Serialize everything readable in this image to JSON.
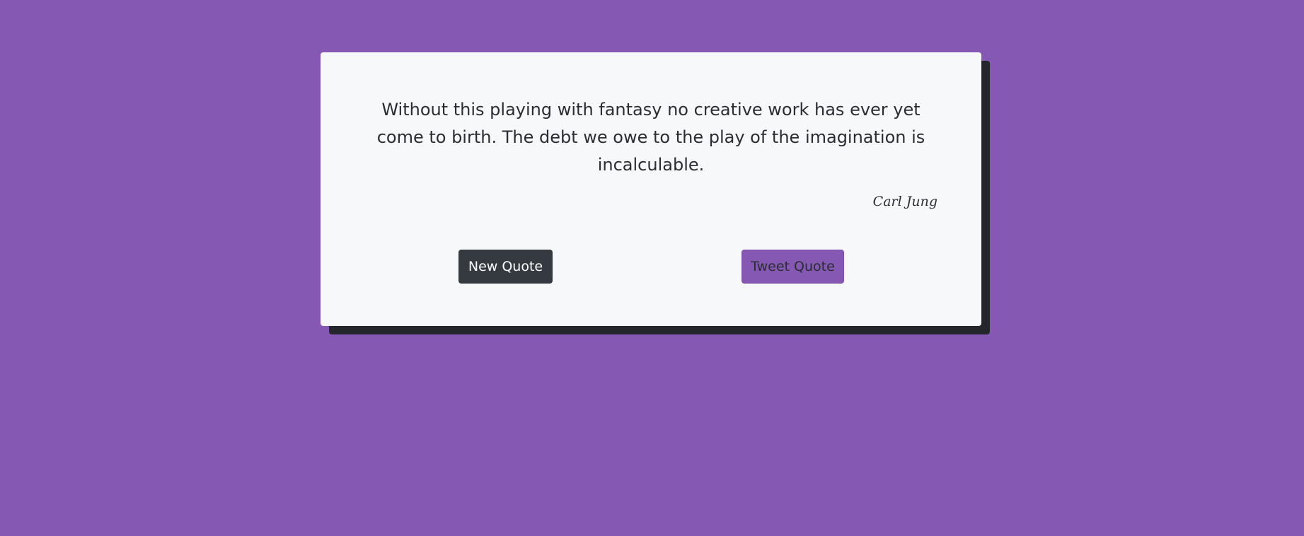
{
  "quote": {
    "text": "Without this playing with fantasy no creative work has ever yet come to birth. The debt we owe to the play of the imagination is incalculable.",
    "author": "Carl Jung"
  },
  "buttons": {
    "new_quote_label": "New Quote",
    "tweet_quote_label": "Tweet Quote"
  },
  "colors": {
    "background": "#8559b3",
    "card": "#f7f8fa",
    "card_shadow": "#23272b",
    "new_quote_button": "#343a40",
    "tweet_quote_button": "#8559b3",
    "text": "#2a2e33"
  }
}
